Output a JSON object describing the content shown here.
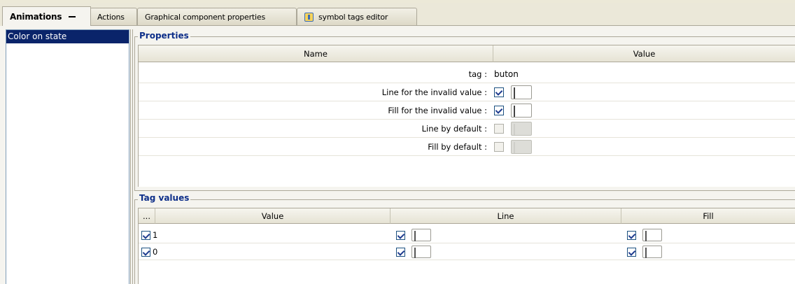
{
  "tabs": {
    "animations": "Animations",
    "actions": "Actions",
    "graphical": "Graphical component properties",
    "symbol_tags": "symbol tags editor"
  },
  "left_list": {
    "items": [
      "Color on state"
    ]
  },
  "properties": {
    "title": "Properties",
    "col_name": "Name",
    "col_value": "Value",
    "rows": [
      {
        "label": "tag :",
        "value": "buton"
      },
      {
        "label": "Line for the invalid value :",
        "checked": true,
        "color": "#0000ff"
      },
      {
        "label": "Fill for the invalid value :",
        "checked": true,
        "color": "#0000ff"
      },
      {
        "label": "Line by default :",
        "checked": false,
        "color": "#d4d0c8"
      },
      {
        "label": "Fill by default :",
        "checked": false,
        "color": "#d4d0c8"
      }
    ]
  },
  "tag_values": {
    "title": "Tag values",
    "col_more": "...",
    "col_value": "Value",
    "col_line": "Line",
    "col_fill": "Fill",
    "rows": [
      {
        "value": "1",
        "line_color": "#00ff00",
        "fill_color": "#00ff00"
      },
      {
        "value": "0",
        "line_color": "#ff0000",
        "fill_color": "#ff0000"
      }
    ]
  }
}
